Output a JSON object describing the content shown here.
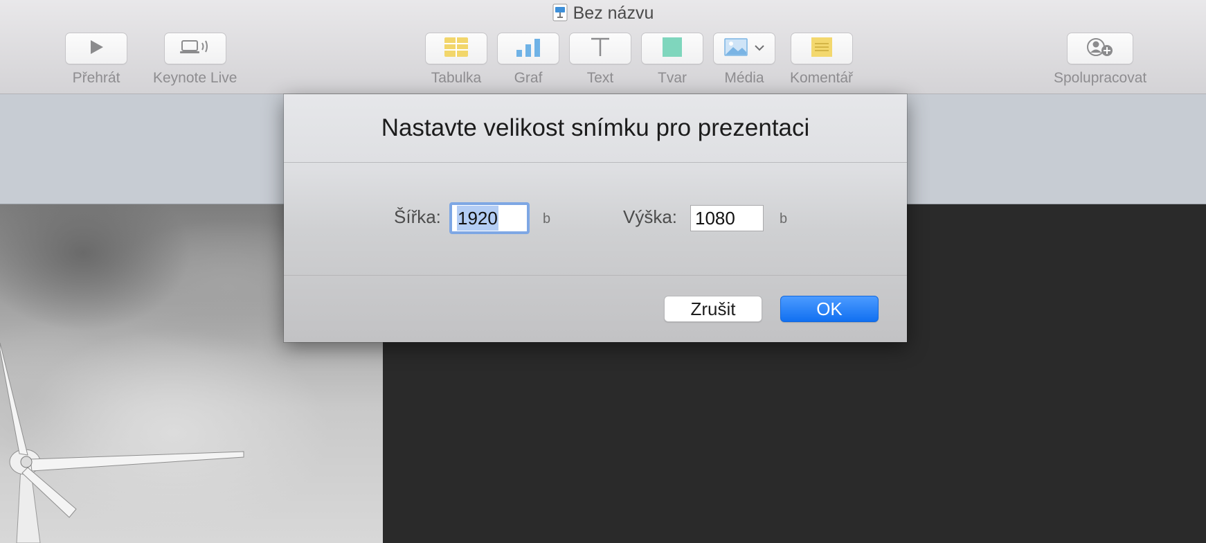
{
  "window": {
    "title": "Bez názvu"
  },
  "toolbar": {
    "play": {
      "label": "Přehrát",
      "icon": "play-icon"
    },
    "keynote_live": {
      "label": "Keynote Live",
      "icon": "laptop-broadcast-icon"
    },
    "table": {
      "label": "Tabulka",
      "icon": "table-icon",
      "color": "#f2d66b"
    },
    "chart": {
      "label": "Graf",
      "icon": "bar-chart-icon",
      "color": "#6fb2e6"
    },
    "text": {
      "label": "Text",
      "icon": "text-icon"
    },
    "shape": {
      "label": "Tvar",
      "icon": "square-shape-icon",
      "color": "#7fd6bd"
    },
    "media": {
      "label": "Média",
      "icon": "image-icon"
    },
    "comment": {
      "label": "Komentář",
      "icon": "comment-icon",
      "color": "#f3d86e"
    },
    "collaborate": {
      "label": "Spolupracovat",
      "icon": "add-person-icon"
    }
  },
  "dialog": {
    "title": "Nastavte velikost snímku pro prezentaci",
    "width": {
      "label": "Šířka:",
      "value": "1920",
      "unit": "b"
    },
    "height": {
      "label": "Výška:",
      "value": "1080",
      "unit": "b"
    },
    "cancel_label": "Zrušit",
    "ok_label": "OK",
    "accent_color": "#1170f1"
  }
}
